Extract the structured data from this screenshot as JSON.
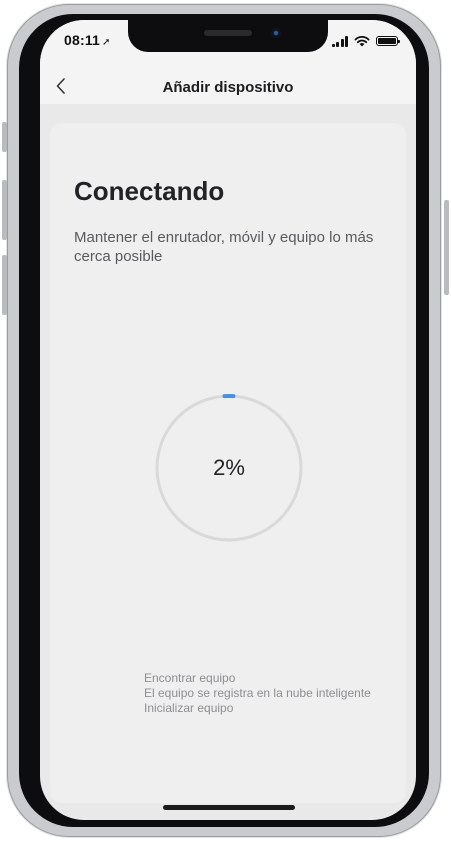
{
  "status_bar": {
    "time": "08:11"
  },
  "nav": {
    "title": "Añadir dispositivo"
  },
  "content": {
    "heading": "Conectando",
    "subtitle": "Mantener el enrutador, móvil y equipo lo más cerca posible",
    "progress": {
      "label": "2%",
      "value_percent": 2,
      "track_color": "#d9d9d9",
      "fill_color": "#4a90d9"
    },
    "steps": [
      "Encontrar equipo",
      "El equipo se registra en la nube inteligente",
      "Inicializar equipo"
    ]
  },
  "icons": {
    "back": "chevron-left-icon",
    "location": "location-arrow-icon",
    "signal": "cellular-signal-icon",
    "wifi": "wifi-icon",
    "battery": "battery-icon"
  }
}
